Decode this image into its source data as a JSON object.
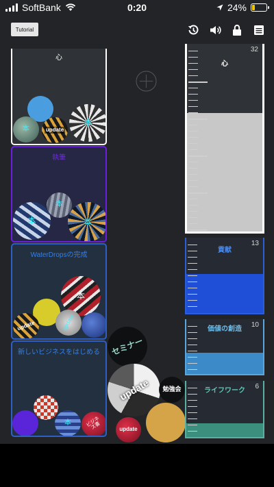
{
  "status_bar": {
    "carrier": "SoftBank",
    "time": "0:20",
    "battery": "24%",
    "battery_level": 0.24
  },
  "toolbar": {
    "tutorial_label": "Tutorial",
    "icons": [
      "history-icon",
      "volume-icon",
      "lock-icon",
      "menu-icon"
    ]
  },
  "add_button": {
    "icon": "plus-circle-icon"
  },
  "containers": [
    {
      "label": "心",
      "border_color": "#ffffff",
      "label_color": "#ffffff"
    },
    {
      "label": "執筆",
      "border_color": "#6a1fe0",
      "label_color": "#6a2bd8"
    },
    {
      "label": "WaterDropsの完成",
      "border_color": "#2d5fc6",
      "label_color": "#3a7fe0"
    },
    {
      "label": "新しいビジネスをはじめる",
      "border_color": "#2d5fc6",
      "label_color": "#3a7fe0"
    }
  ],
  "balls": {
    "b1": "本",
    "b2": "update",
    "b3": "本",
    "b4": "本",
    "b5": "本",
    "b6": "本",
    "b7": "本",
    "b8": "update",
    "b9": "update",
    "b10": "本",
    "b11": "ビジネス書",
    "free1": "セミナー",
    "free2": "update",
    "free3": "勉強会",
    "free4": "update"
  },
  "gauges": [
    {
      "label": "心",
      "value": "32",
      "fill_ratio": 0.63,
      "fill_color": "#c8c8c8",
      "border_color": "#ffffff",
      "label_color": "#ffffff"
    },
    {
      "label": "貢献",
      "value": "13",
      "fill_ratio": 0.52,
      "fill_color": "#1f4fd6",
      "border_color": "#2a5fd8",
      "label_color": "#4a8cf0"
    },
    {
      "label": "価値の創造",
      "value": "10",
      "fill_ratio": 0.39,
      "fill_color": "#3d8ac8",
      "border_color": "#5aa6e0",
      "label_color": "#6bbce8"
    },
    {
      "label": "ライフワーク",
      "value": "6",
      "fill_ratio": 0.25,
      "fill_color": "#3c8f7c",
      "border_color": "#5ab0a0",
      "label_color": "#62c4b4"
    }
  ]
}
